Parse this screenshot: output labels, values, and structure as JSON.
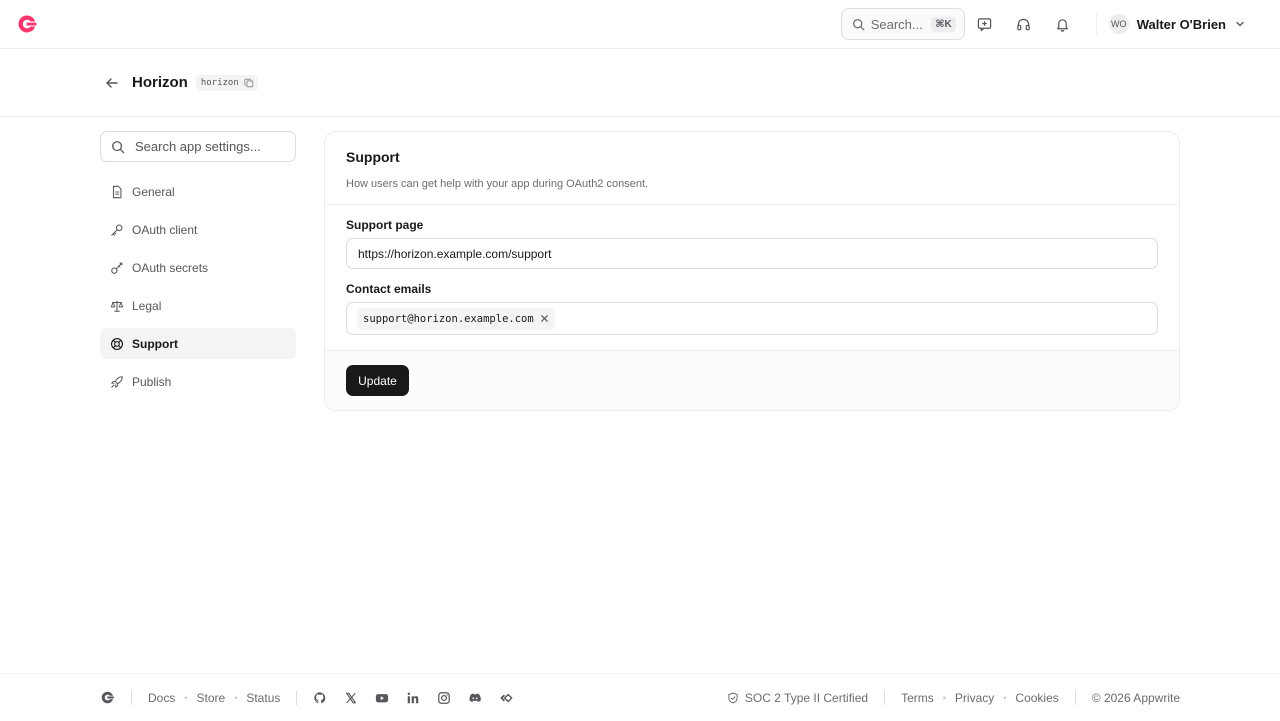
{
  "topbar": {
    "search_label": "Search...",
    "search_shortcut": "⌘K",
    "user": {
      "initials": "WO",
      "name": "Walter O'Brien"
    }
  },
  "header": {
    "app_title": "Horizon",
    "app_id": "horizon"
  },
  "sidebar": {
    "search_placeholder": "Search app settings...",
    "items": [
      {
        "label": "General",
        "icon": "document-icon"
      },
      {
        "label": "OAuth client",
        "icon": "key-icon"
      },
      {
        "label": "OAuth secrets",
        "icon": "key-secret-icon"
      },
      {
        "label": "Legal",
        "icon": "scale-icon"
      },
      {
        "label": "Support",
        "icon": "lifebuoy-icon",
        "active": true
      },
      {
        "label": "Publish",
        "icon": "rocket-icon"
      }
    ]
  },
  "card": {
    "title": "Support",
    "description": "How users can get help with your app during OAuth2 consent.",
    "support_page_label": "Support page",
    "support_page_value": "https://horizon.example.com/support",
    "contact_emails_label": "Contact emails",
    "contact_emails": [
      "support@horizon.example.com"
    ],
    "update_label": "Update"
  },
  "footer": {
    "links": [
      "Docs",
      "Store",
      "Status"
    ],
    "soc": "SOC 2 Type II Certified",
    "legal_links": [
      "Terms",
      "Privacy",
      "Cookies"
    ],
    "copyright": "© 2026 Appwrite"
  },
  "colors": {
    "brand": "#fd366e",
    "primary_button": "#19191c",
    "border": "#ededf0"
  }
}
